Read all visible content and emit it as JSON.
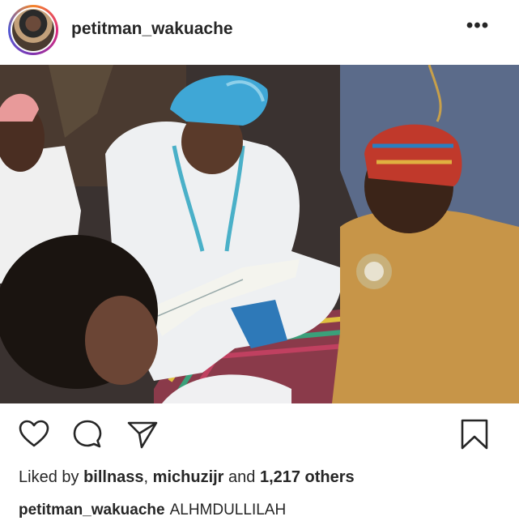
{
  "post": {
    "username": "petitman_wakuache",
    "more_icon": "more-icon",
    "more_label": "•••",
    "photo_icon": "post-photo",
    "likes": {
      "prefix": "Liked by ",
      "user1": "billnass",
      "separator": ", ",
      "user2": "michuzijr",
      "and": " and ",
      "others": "1,217 others"
    },
    "caption": {
      "username": "petitman_wakuache",
      "text": "ALHMDULLILAH"
    }
  },
  "actions": {
    "like_icon": "heart-icon",
    "comment_icon": "comment-icon",
    "share_icon": "share-icon",
    "save_icon": "bookmark-icon"
  },
  "colors": {
    "text": "#262626",
    "background": "#ffffff"
  }
}
